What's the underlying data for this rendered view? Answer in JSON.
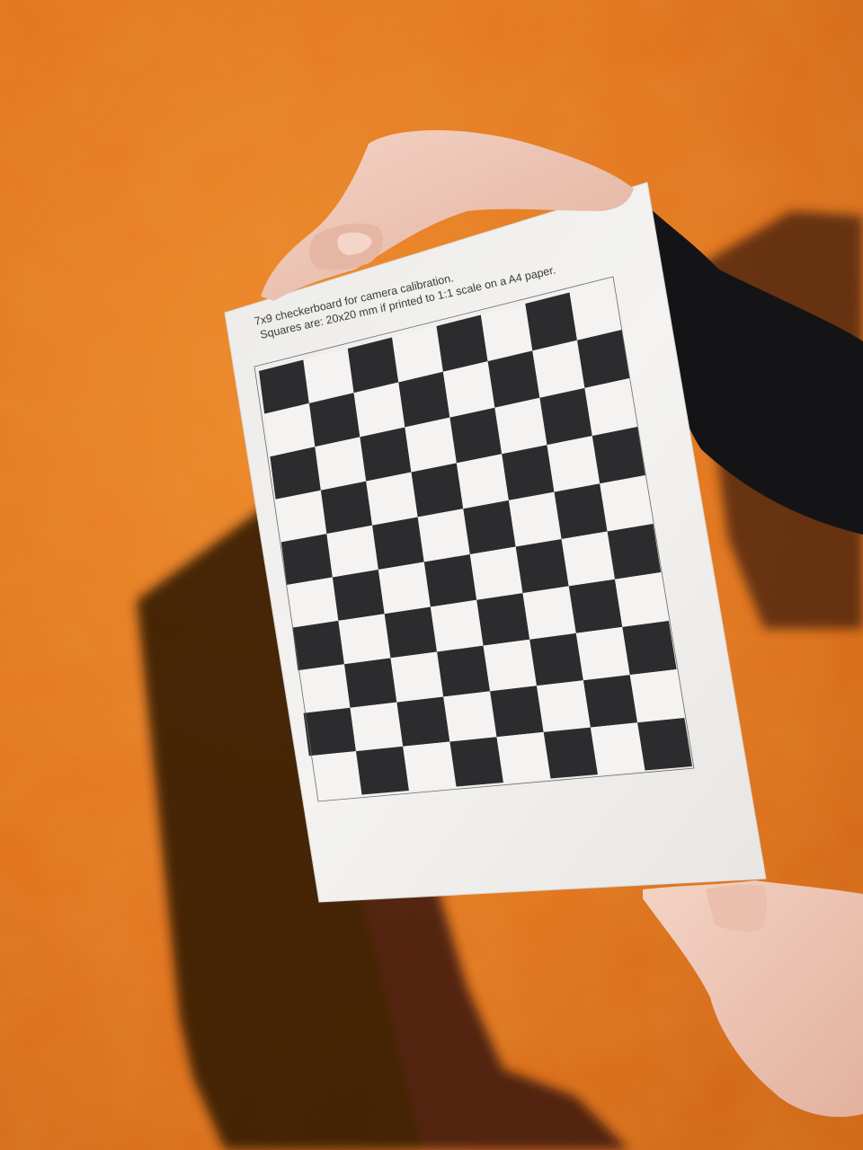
{
  "caption": {
    "line1": "7x9 checkerboard for camera calibration.",
    "line2": "Squares are: 20x20 mm if printed to 1:1 scale on a A4 paper."
  },
  "checkerboard": {
    "columns": 8,
    "rows": 10,
    "first_square_dark": true
  },
  "colors": {
    "wall": "#e3741f",
    "wall_dark": "#c85a12",
    "shadow": "#2b1206",
    "paper": "#f2f1ef",
    "dark_square": "#2c2c2e",
    "light_square": "#f4f3f1",
    "sleeve": "#141416",
    "skin": "#f0c9b8"
  }
}
